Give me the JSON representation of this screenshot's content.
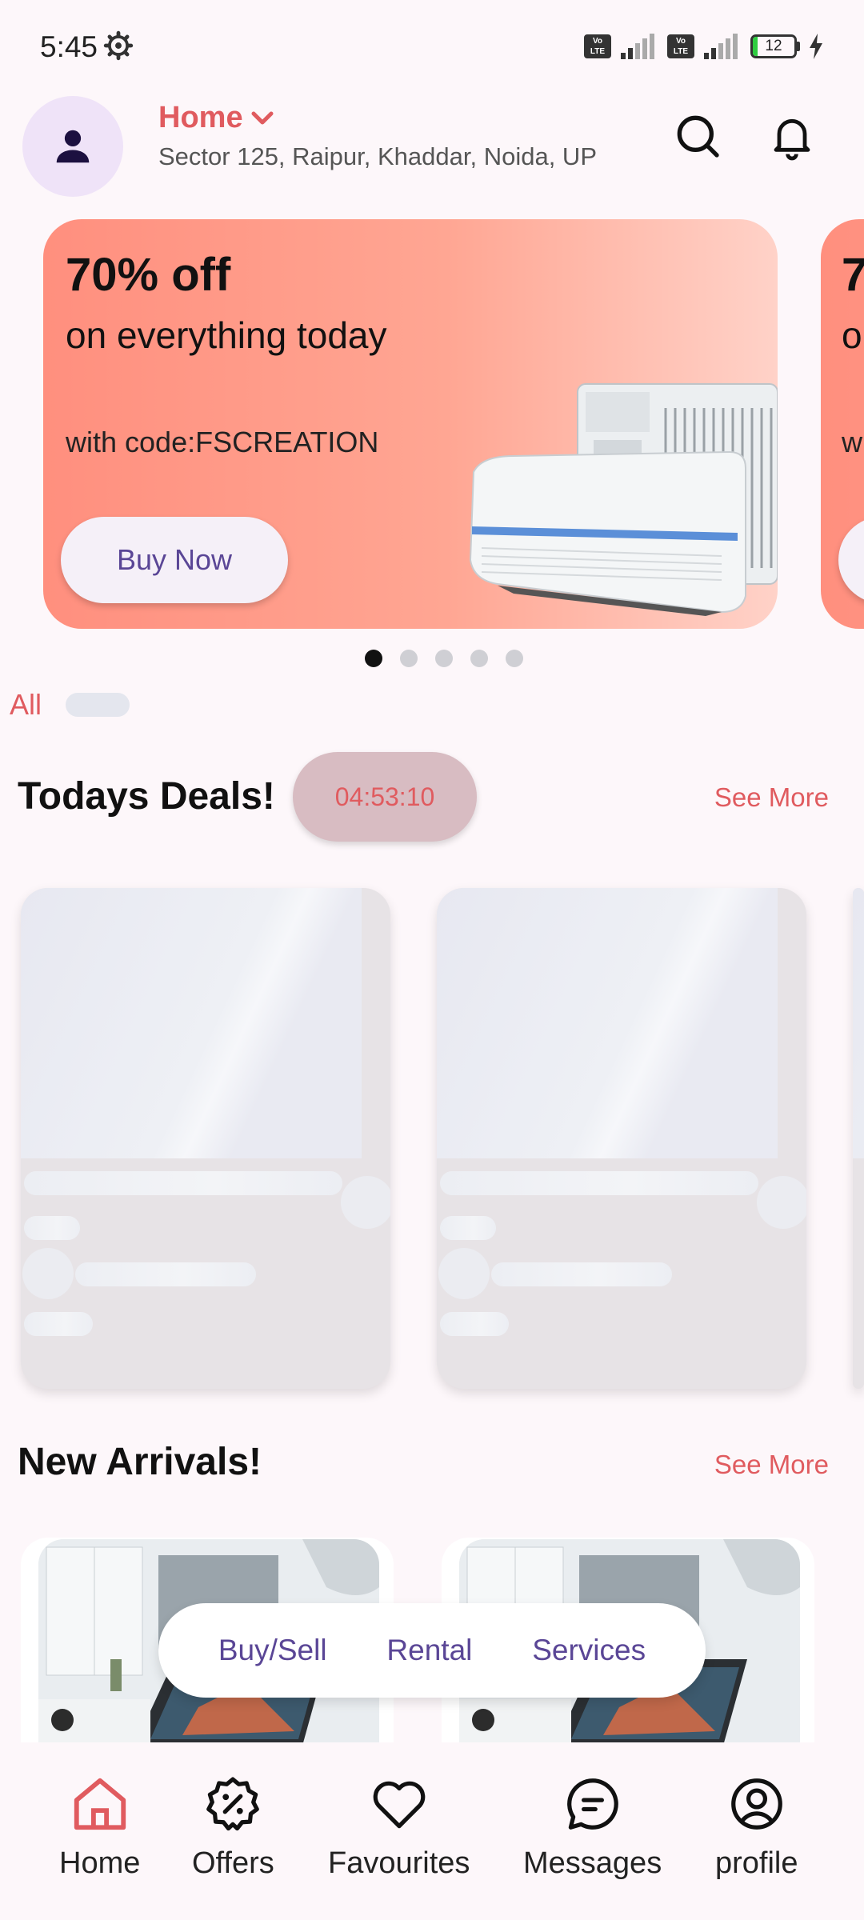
{
  "status_bar": {
    "time": "5:45",
    "battery": "12",
    "battery_level": 0.12
  },
  "header": {
    "location_title": "Home",
    "address": "Sector 125, Raipur, Khaddar, Noida, UP"
  },
  "banner": {
    "headline": "70% off",
    "subline": "on everything today",
    "code_line": "with code:FSCREATION",
    "button_label": "Buy Now",
    "peek_headline": "7",
    "peek_subline": "o",
    "peek_code": "w",
    "slide_count": 5,
    "active_slide": 1
  },
  "categories": {
    "first": "All"
  },
  "todays_deals": {
    "title": "Todays Deals!",
    "timer": "04:53:10",
    "see_more": "See More"
  },
  "new_arrivals": {
    "title": "New Arrivals!",
    "see_more": "See More"
  },
  "float_tabs": [
    "Buy/Sell",
    "Rental",
    "Services"
  ],
  "bottom_nav": [
    "Home",
    "Offers",
    "Favourites",
    "Messages",
    "profile"
  ],
  "colors": {
    "accent": "#e05b5f",
    "primary_text": "#5a4696",
    "banner": "#ff8f7e"
  }
}
